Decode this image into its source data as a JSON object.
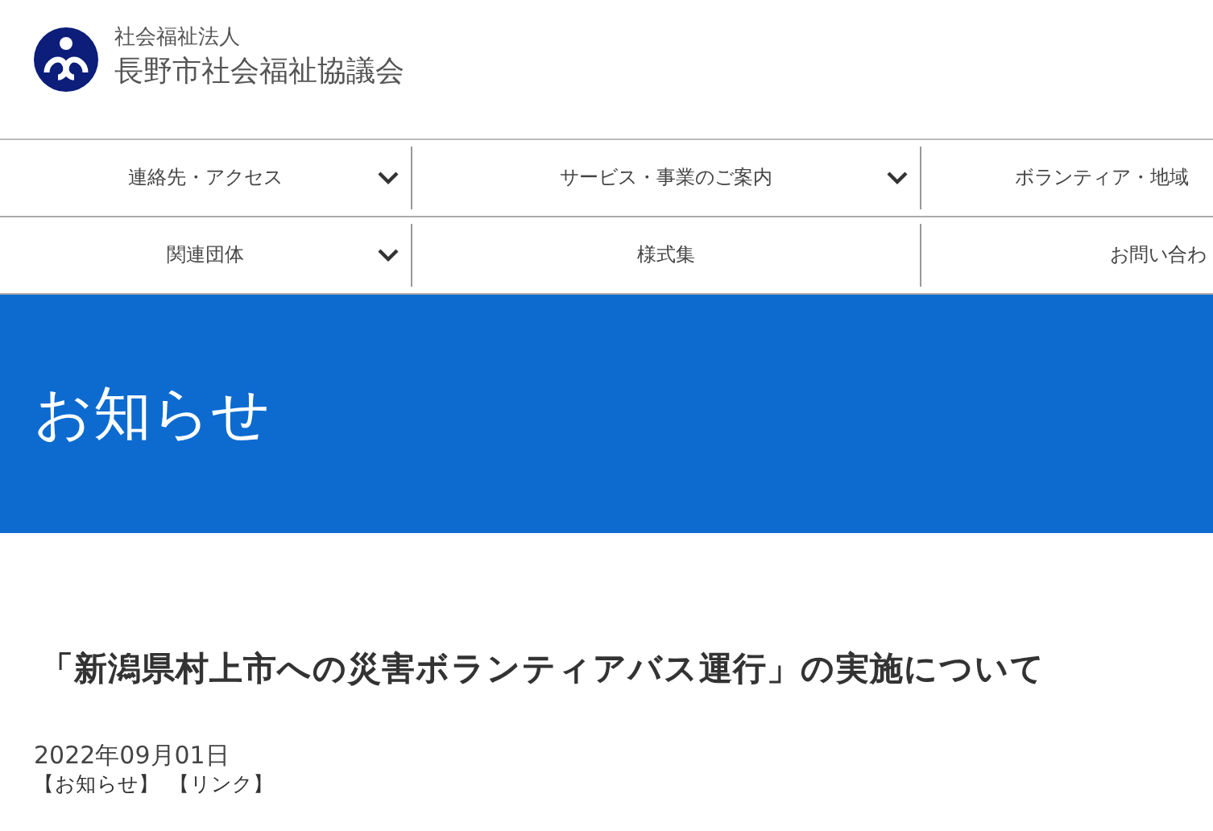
{
  "header": {
    "org_type": "社会福祉法人",
    "org_name": "長野市社会福祉協議会"
  },
  "nav": [
    [
      {
        "label": "連絡先・アクセス",
        "has_menu": true
      },
      {
        "label": "サービス・事業のご案内",
        "has_menu": true
      },
      {
        "label": "ボランティア・地域",
        "has_menu": false
      }
    ],
    [
      {
        "label": "関連団体",
        "has_menu": true
      },
      {
        "label": "様式集",
        "has_menu": false
      },
      {
        "label": "お問い合わ",
        "has_menu": false
      }
    ]
  ],
  "banner": {
    "title": "お知らせ"
  },
  "article": {
    "title": "「新潟県村上市への災害ボランティアバス運行」の実施について",
    "date": "2022年09月01日",
    "tags": [
      "【お知らせ】",
      "【リンク】"
    ]
  }
}
